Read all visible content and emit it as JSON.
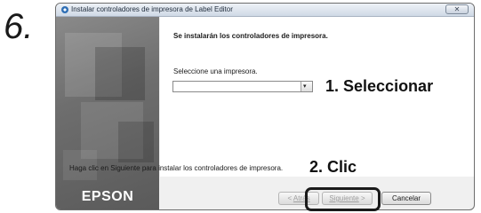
{
  "step": {
    "number": "6."
  },
  "window": {
    "title": "Instalar controladores de impresora de Label Editor",
    "close_glyph": "✕"
  },
  "sidebar": {
    "brand": "EPSON"
  },
  "content": {
    "heading": "Se instalarán los controladores de impresora.",
    "select_label": "Seleccione una impresora.",
    "printer_value": "",
    "footer_note": "Haga clic en Siguiente para instalar los controladores de impresora."
  },
  "buttons": {
    "back": {
      "arrow": "< ",
      "label": "Atrás",
      "enabled": false
    },
    "next": {
      "label": "Siguiente",
      "arrow": " >",
      "enabled": false
    },
    "cancel": {
      "label": "Cancelar",
      "enabled": true
    }
  },
  "annotations": {
    "callout_select": "1. Seleccionar",
    "callout_click": "2. Clic"
  },
  "colors": {
    "sidebar": "#6e6e6e",
    "titlebar": "#cfd9e6",
    "highlight": "#1a1a1a"
  }
}
